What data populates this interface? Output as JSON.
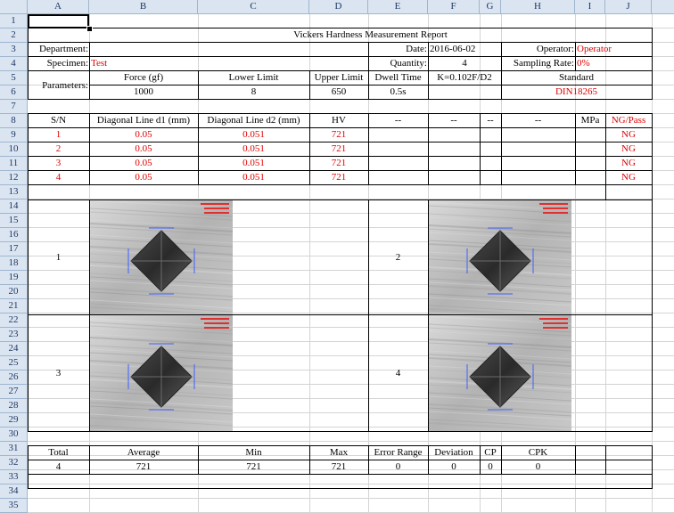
{
  "columns": [
    "A",
    "B",
    "C",
    "D",
    "E",
    "F",
    "G",
    "H",
    "I",
    "J"
  ],
  "rows": [
    "1",
    "2",
    "3",
    "4",
    "5",
    "6",
    "7",
    "8",
    "9",
    "10",
    "11",
    "12",
    "13",
    "14",
    "15",
    "16",
    "17",
    "18",
    "19",
    "20",
    "21",
    "22",
    "23",
    "24",
    "25",
    "26",
    "27",
    "28",
    "29",
    "30",
    "31",
    "32",
    "33",
    "34",
    "35"
  ],
  "report": {
    "title": "Vickers Hardness Measurement Report",
    "department_label": "Department:",
    "date_label": "Date:",
    "date_value": "2016-06-02",
    "operator_label": "Operator:",
    "operator_value": "Operator",
    "specimen_label": "Specimen:",
    "specimen_value": "Test",
    "quantity_label": "Quantity:",
    "quantity_value": "4",
    "sampling_label": "Sampling Rate:",
    "sampling_value": "0%",
    "parameters_label": "Parameters:",
    "force_label": "Force (gf)",
    "lower_label": "Lower Limit",
    "upper_label": "Upper Limit",
    "dwell_label": "Dwell Time",
    "k_label": "K=0.102F/D2",
    "standard_label": "Standard",
    "force_value": "1000",
    "lower_value": "8",
    "upper_value": "650",
    "dwell_value": "0.5s",
    "standard_value": "DIN18265"
  },
  "table": {
    "headers": [
      "S/N",
      "Diagonal Line d1 (mm)",
      "Diagonal Line d2 (mm)",
      "HV",
      "--",
      "--",
      "--",
      "--",
      "MPa",
      "NG/Pass"
    ],
    "rows": [
      {
        "sn": "1",
        "d1": "0.05",
        "d2": "0.051",
        "hv": "721",
        "result": "NG"
      },
      {
        "sn": "2",
        "d1": "0.05",
        "d2": "0.051",
        "hv": "721",
        "result": "NG"
      },
      {
        "sn": "3",
        "d1": "0.05",
        "d2": "0.051",
        "hv": "721",
        "result": "NG"
      },
      {
        "sn": "4",
        "d1": "0.05",
        "d2": "0.051",
        "hv": "721",
        "result": "NG"
      }
    ]
  },
  "images": {
    "labels": [
      "1",
      "2",
      "3",
      "4"
    ]
  },
  "summary": {
    "headers": [
      "Total",
      "Average",
      "Min",
      "Max",
      "Error Range",
      "Deviation",
      "CP",
      "CPK"
    ],
    "values": [
      "4",
      "721",
      "721",
      "721",
      "0",
      "0",
      "0",
      "0"
    ]
  }
}
